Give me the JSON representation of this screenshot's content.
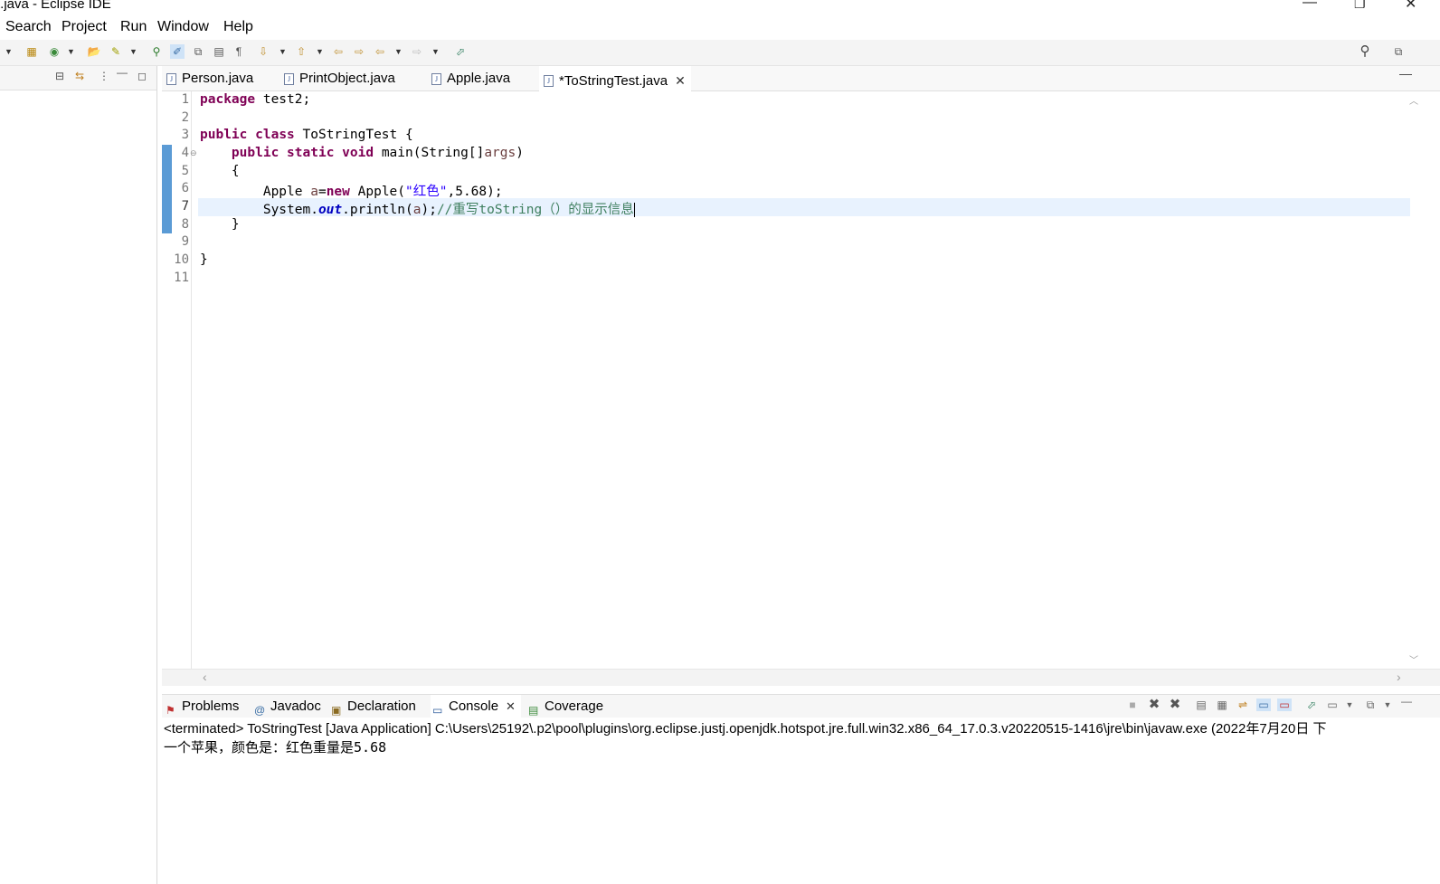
{
  "window": {
    "title": "t.java - Eclipse IDE"
  },
  "menu": [
    "Search",
    "Project",
    "Run",
    "Window",
    "Help"
  ],
  "editor_tabs": [
    {
      "label": "Person.java",
      "active": false
    },
    {
      "label": "PrintObject.java",
      "active": false
    },
    {
      "label": "Apple.java",
      "active": false
    },
    {
      "label": "*ToStringTest.java",
      "active": true
    }
  ],
  "editor": {
    "line_numbers": [
      "1",
      "2",
      "3",
      "4",
      "5",
      "6",
      "7",
      "8",
      "9",
      "10",
      "11"
    ],
    "current_line": "7",
    "lines": {
      "l1_kw": "package",
      "l1_rest": " test2;",
      "l3_kw1": "public",
      "l3_kw2": "class",
      "l3_rest": " ToStringTest {",
      "l4_kw1": "public",
      "l4_kw2": "static",
      "l4_kw3": "void",
      "l4_mid": " main(String[]",
      "l4_var": "args",
      "l4_end": ")",
      "l5": "{",
      "l6_a": "Apple ",
      "l6_var": "a",
      "l6_eq": "=",
      "l6_kw": "new",
      "l6_b": " Apple(",
      "l6_str": "\"红色\"",
      "l6_c": ",5.68);",
      "l7_a": "System.",
      "l7_fld": "out",
      "l7_b": ".println(",
      "l7_var": "a",
      "l7_c": ");",
      "l7_cmt": "//重写toString（）的显示信息",
      "l8": "}",
      "l10": "}"
    }
  },
  "bottom_tabs": [
    {
      "label": "Problems",
      "icon": "problems-icon"
    },
    {
      "label": "Javadoc",
      "icon": "javadoc-icon"
    },
    {
      "label": "Declaration",
      "icon": "declaration-icon"
    },
    {
      "label": "Console",
      "icon": "console-icon",
      "active": true
    },
    {
      "label": "Coverage",
      "icon": "coverage-icon"
    }
  ],
  "console": {
    "terminated": "<terminated> ToStringTest [Java Application] C:\\Users\\25192\\.p2\\pool\\plugins\\org.eclipse.justj.openjdk.hotspot.jre.full.win32.x86_64_17.0.3.v20220515-1416\\jre\\bin\\javaw.exe  (2022年7月20日 下",
    "output": "一个苹果，颜色是：红色重量是5.68"
  },
  "colors": {
    "keyword": "#7f0055",
    "string": "#2a00ff",
    "comment": "#3f7f5f",
    "field": "#0000c0",
    "current_line": "#e8f2fe",
    "change_marker": "#5b9bd5"
  }
}
